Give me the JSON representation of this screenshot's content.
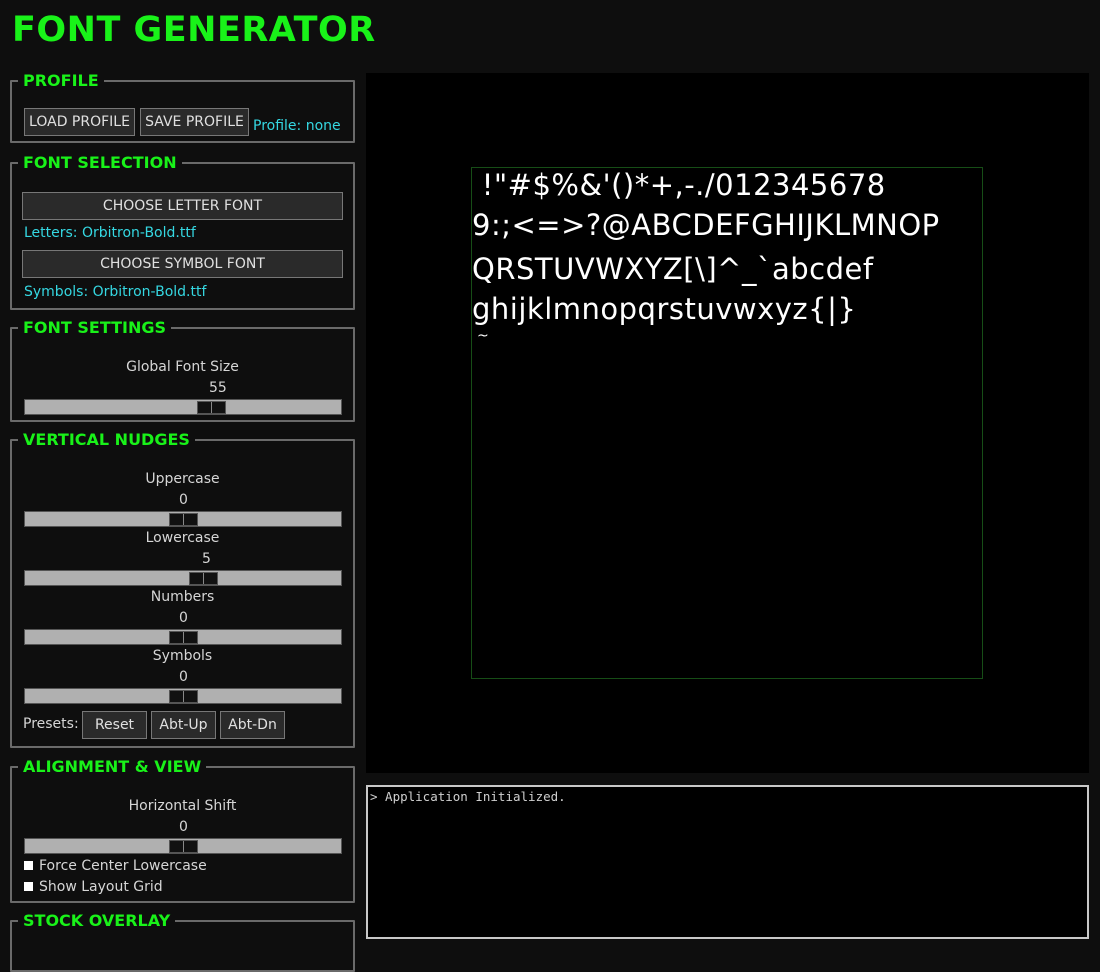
{
  "app": {
    "title": "FONT GENERATOR"
  },
  "profile": {
    "legend": "PROFILE",
    "load_label": "LOAD PROFILE",
    "save_label": "SAVE PROFILE",
    "status": "Profile: none"
  },
  "font_selection": {
    "legend": "FONT SELECTION",
    "letter_button": "CHOOSE LETTER FONT",
    "letter_file": "Letters: Orbitron-Bold.ttf",
    "symbol_button": "CHOOSE SYMBOL FONT",
    "symbol_file": "Symbols: Orbitron-Bold.ttf"
  },
  "font_settings": {
    "legend": "FONT SETTINGS",
    "size_label": "Global Font Size",
    "size_value": "55",
    "size_fraction": 0.6
  },
  "vertical_nudges": {
    "legend": "VERTICAL NUDGES",
    "uppercase": {
      "label": "Uppercase",
      "value": "0",
      "fraction": 0.5
    },
    "lowercase": {
      "label": "Lowercase",
      "value": "5",
      "fraction": 0.57
    },
    "numbers": {
      "label": "Numbers",
      "value": "0",
      "fraction": 0.5
    },
    "symbols": {
      "label": "Symbols",
      "value": "0",
      "fraction": 0.5
    },
    "presets_label": "Presets:",
    "presets": [
      "Reset",
      "Abt-Up",
      "Abt-Dn"
    ]
  },
  "alignment": {
    "legend": "ALIGNMENT & VIEW",
    "hshift_label": "Horizontal Shift",
    "hshift_value": "0",
    "hshift_fraction": 0.5,
    "force_center": "Force Center Lowercase",
    "show_grid": "Show Layout Grid"
  },
  "stock_overlay": {
    "legend": "STOCK OVERLAY"
  },
  "preview": {
    "rows": [
      " !\"#$%&'()*+,-./012345678",
      "9:;<=>?@ABCDEFGHIJKLMNOP",
      "QRSTUVWXYZ[\\]^_`abcdef",
      "ghijklmnopqrstuvwxyz{|}",
      " ~"
    ]
  },
  "console": {
    "line": "> Application Initialized."
  },
  "colors": {
    "accent": "#19f219",
    "info": "#35d8e2",
    "panel": "#0e0e0e",
    "preview_bg": "#000000"
  }
}
